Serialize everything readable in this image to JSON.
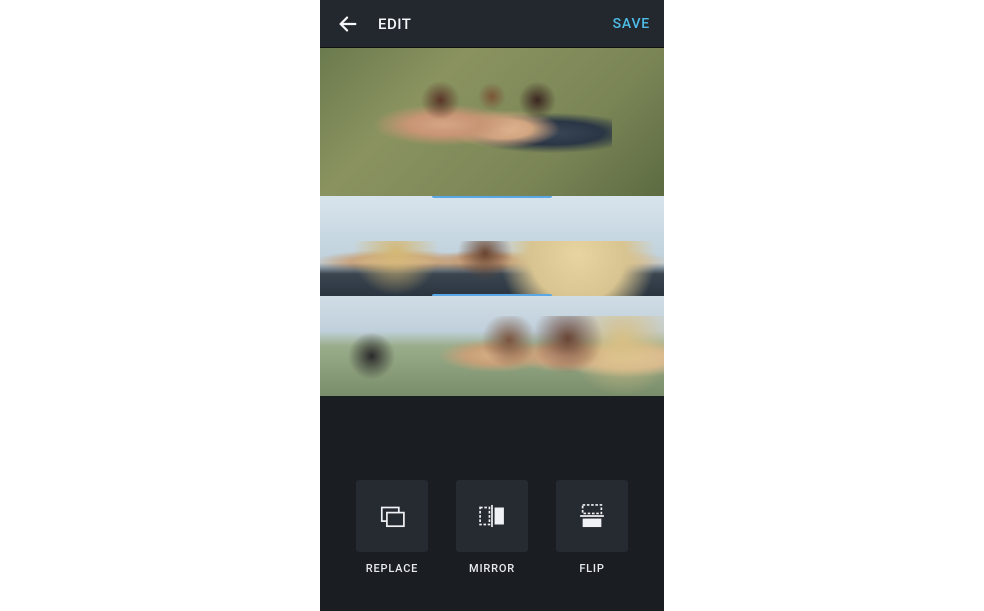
{
  "header": {
    "title": "EDIT",
    "save_label": "SAVE"
  },
  "collage": {
    "slots": [
      {
        "selected": false
      },
      {
        "selected": true
      },
      {
        "selected": false
      }
    ]
  },
  "toolbar": {
    "replace_label": "REPLACE",
    "mirror_label": "MIRROR",
    "flip_label": "FLIP"
  }
}
